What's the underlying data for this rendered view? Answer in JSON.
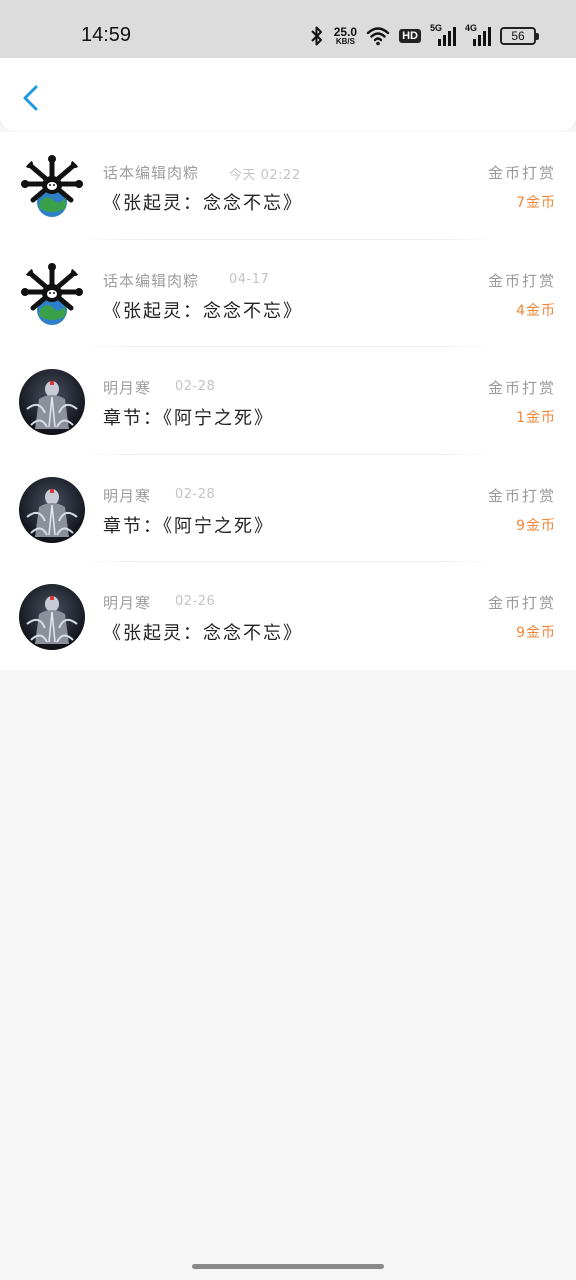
{
  "status_bar": {
    "time": "14:59",
    "net_speed_value": "25.0",
    "net_speed_unit": "KB/S",
    "hd_label": "HD",
    "sim1_gen": "5G",
    "sim2_gen": "4G",
    "battery": "56"
  },
  "header": {
    "back_icon": "chevron-left-icon",
    "accent": "#1e9be0"
  },
  "colors": {
    "amount": "#f0873a",
    "name": "#9e9e9e",
    "time": "#c4c4c4",
    "title": "#222222"
  },
  "records": [
    {
      "name": "话本编辑肉粽",
      "time": "今天 02:22",
      "title": "《张起灵：念念不忘》",
      "tip_label": "金币打赏",
      "amount": "7金币",
      "avatar": "skull-cartoon"
    },
    {
      "name": "话本编辑肉粽",
      "time": "04-17",
      "title": "《张起灵：念念不忘》",
      "tip_label": "金币打赏",
      "amount": "4金币",
      "avatar": "skull-cartoon"
    },
    {
      "name": "明月寒",
      "time": "02-28",
      "title": "章节：《阿宁之死》",
      "tip_label": "金币打赏",
      "amount": "1金币",
      "avatar": "dark-figure"
    },
    {
      "name": "明月寒",
      "time": "02-28",
      "title": "章节：《阿宁之死》",
      "tip_label": "金币打赏",
      "amount": "9金币",
      "avatar": "dark-figure"
    },
    {
      "name": "明月寒",
      "time": "02-26",
      "title": "《张起灵：念念不忘》",
      "tip_label": "金币打赏",
      "amount": "9金币",
      "avatar": "dark-figure"
    }
  ]
}
